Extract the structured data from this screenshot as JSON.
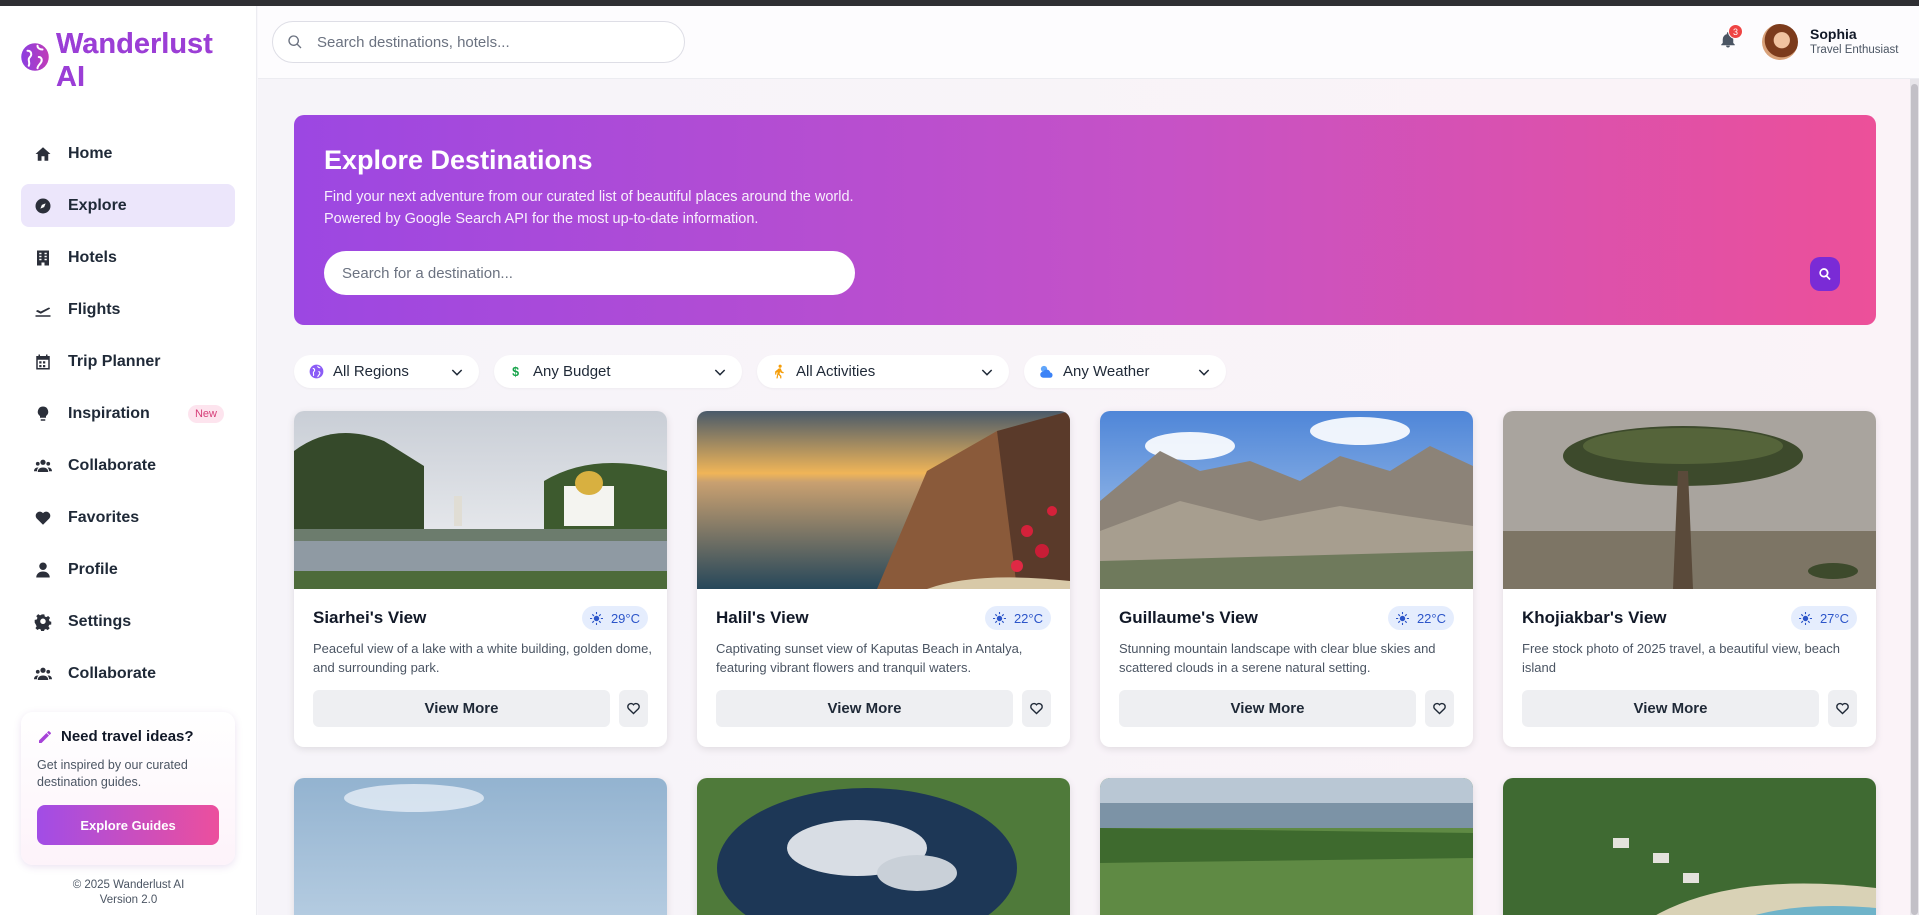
{
  "brand": {
    "name": "Wanderlust AI"
  },
  "sidebar": {
    "items": [
      {
        "label": "Home",
        "icon": "home-icon"
      },
      {
        "label": "Explore",
        "icon": "compass-icon",
        "active": true
      },
      {
        "label": "Hotels",
        "icon": "hotel-icon"
      },
      {
        "label": "Flights",
        "icon": "plane-icon"
      },
      {
        "label": "Trip Planner",
        "icon": "calendar-icon"
      },
      {
        "label": "Inspiration",
        "icon": "lightbulb-icon",
        "badge": "New"
      },
      {
        "label": "Collaborate",
        "icon": "users-icon"
      },
      {
        "label": "Favorites",
        "icon": "heart-icon"
      },
      {
        "label": "Profile",
        "icon": "user-icon"
      },
      {
        "label": "Settings",
        "icon": "gear-icon"
      },
      {
        "label": "Collaborate",
        "icon": "users-icon"
      }
    ],
    "promo": {
      "title": "Need travel ideas?",
      "text": "Get inspired by our curated destination guides.",
      "button": "Explore Guides"
    },
    "copyright": "© 2025 Wanderlust AI",
    "version": "Version 2.0"
  },
  "header": {
    "search_placeholder": "Search destinations, hotels...",
    "notification_count": "3",
    "user": {
      "name": "Sophia",
      "role": "Travel Enthusiast"
    }
  },
  "hero": {
    "title": "Explore Destinations",
    "subtitle_line1": "Find your next adventure from our curated list of beautiful places around the world.",
    "subtitle_line2": "Powered by Google Search API for the most up-to-date information.",
    "search_placeholder": "Search for a destination..."
  },
  "filters": [
    {
      "label": "All Regions",
      "icon": "globe-icon"
    },
    {
      "label": "Any Budget",
      "icon": "dollar-icon"
    },
    {
      "label": "All Activities",
      "icon": "hiking-icon"
    },
    {
      "label": "Any Weather",
      "icon": "weather-icon"
    }
  ],
  "cards": [
    {
      "title": "Siarhei's View",
      "temp": "29°C",
      "desc": "Peaceful view of a lake with a white building, golden dome, and surrounding park.",
      "button": "View More"
    },
    {
      "title": "Halil's View",
      "temp": "22°C",
      "desc": "Captivating sunset view of Kaputas Beach in Antalya, featuring vibrant flowers and tranquil waters.",
      "button": "View More"
    },
    {
      "title": "Guillaume's View",
      "temp": "22°C",
      "desc": "Stunning mountain landscape with clear blue skies and scattered clouds in a serene natural setting.",
      "button": "View More"
    },
    {
      "title": "Khojiakbar's View",
      "temp": "27°C",
      "desc": "Free stock photo of 2025 travel, a beautiful view, beach island",
      "button": "View More"
    }
  ],
  "colors": {
    "accent": "#9c47e2",
    "accent_pink": "#ec5099",
    "temp_badge": "#e5edfd"
  }
}
